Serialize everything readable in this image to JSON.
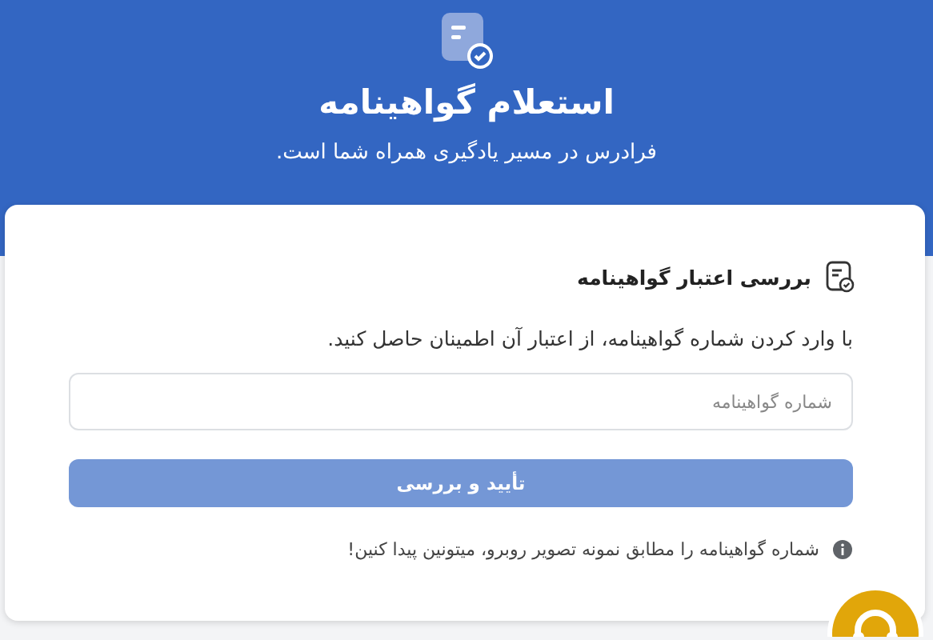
{
  "header": {
    "title": "استعلام گواهینامه",
    "subtitle": "فرادرس در مسیر یادگیری همراه شما است."
  },
  "card": {
    "heading": "بررسی اعتبار گواهینامه",
    "description": "با وارد کردن شماره گواهینامه، از اعتبار آن اطمینان حاصل کنید.",
    "field": {
      "placeholder": "شماره گواهینامه"
    },
    "button": {
      "label": "تأیید و بررسی",
      "disabled": true
    },
    "hint": "شماره گواهینامه را مطابق نمونه تصویر روبرو، میتونین پیدا کنین!"
  }
}
